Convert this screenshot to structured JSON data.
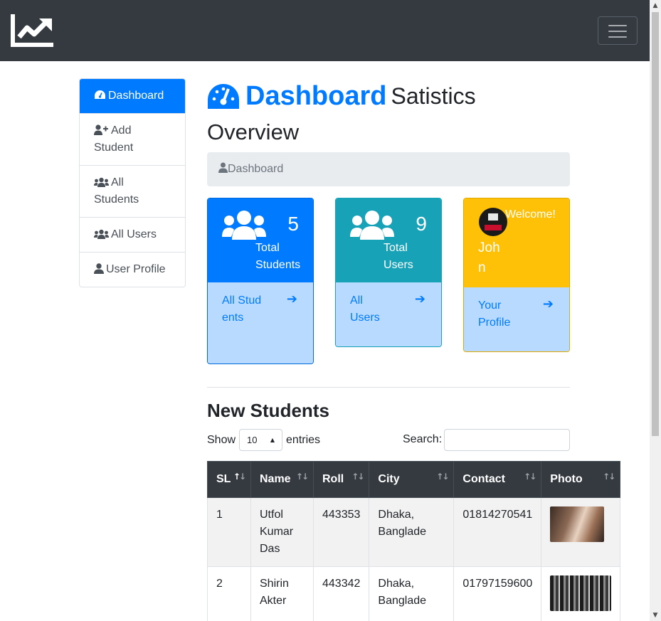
{
  "navbar": {
    "brand_icon": "chart-line-icon",
    "toggler_icon": "hamburger-icon"
  },
  "sidebar": {
    "items": [
      {
        "label": "Dashboard",
        "icon": "tachometer-icon"
      },
      {
        "label": "Add Student",
        "icon": "user-plus-icon"
      },
      {
        "label": "All Students",
        "icon": "users-icon"
      },
      {
        "label": "All Users",
        "icon": "users-icon"
      },
      {
        "label": "User Profile",
        "icon": "user-icon"
      }
    ]
  },
  "header": {
    "title": "Dashboard",
    "subtitle": "Satistics",
    "section": "Overview",
    "icon": "tachometer-icon"
  },
  "breadcrumb": {
    "label": "Dashboard",
    "icon": "user-icon"
  },
  "cards": [
    {
      "count": "5",
      "label": "Total Students",
      "link": "All Students",
      "color": "#007bff"
    },
    {
      "count": "9",
      "label": "Total Users",
      "link": "All Users",
      "color": "#17a2b8"
    },
    {
      "greeting": "Welcome!",
      "name": "John",
      "link": "Your Profile",
      "color": "#ffc107"
    }
  ],
  "new_students": {
    "title": "New Students",
    "show_label": "Show",
    "entries_value": "10",
    "entries_label": "entries",
    "search_label": "Search:",
    "columns": [
      "SL",
      "Name",
      "Roll",
      "City",
      "Contact",
      "Photo"
    ],
    "rows": [
      {
        "sl": "1",
        "name": "Utfol Kumar Das",
        "roll": "443353",
        "city": "Dhaka, Banglade",
        "contact": "01814270541"
      },
      {
        "sl": "2",
        "name": "Shirin Akter",
        "roll": "443342",
        "city": "Dhaka, Banglade",
        "contact": "01797159600"
      }
    ]
  }
}
